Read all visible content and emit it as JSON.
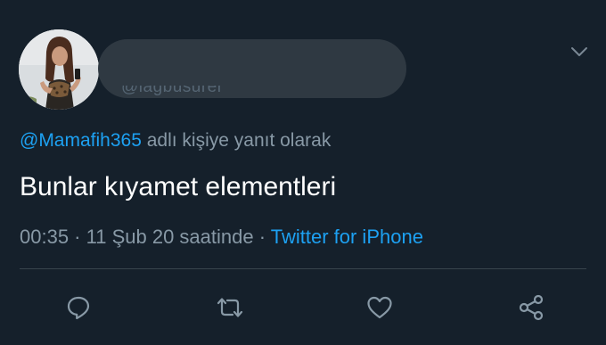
{
  "tweet": {
    "handle_partial": "@lagbusurer",
    "reply_mention": "@Mamafih365",
    "reply_suffix": " adlı kişiye yanıt olarak",
    "text": "Bunlar kıyamet elementleri",
    "time": "00:35",
    "separator": " · ",
    "date": "11 Şub 20 saatinde",
    "source": "Twitter for iPhone"
  },
  "actions": [
    {
      "name": "reply",
      "icon": "reply-icon"
    },
    {
      "name": "retweet",
      "icon": "retweet-icon"
    },
    {
      "name": "like",
      "icon": "heart-icon"
    },
    {
      "name": "share",
      "icon": "share-icon"
    }
  ],
  "colors": {
    "background": "#15202b",
    "text": "#ffffff",
    "secondary": "#8899a6",
    "link": "#1da1f2",
    "divider": "#38444d"
  }
}
